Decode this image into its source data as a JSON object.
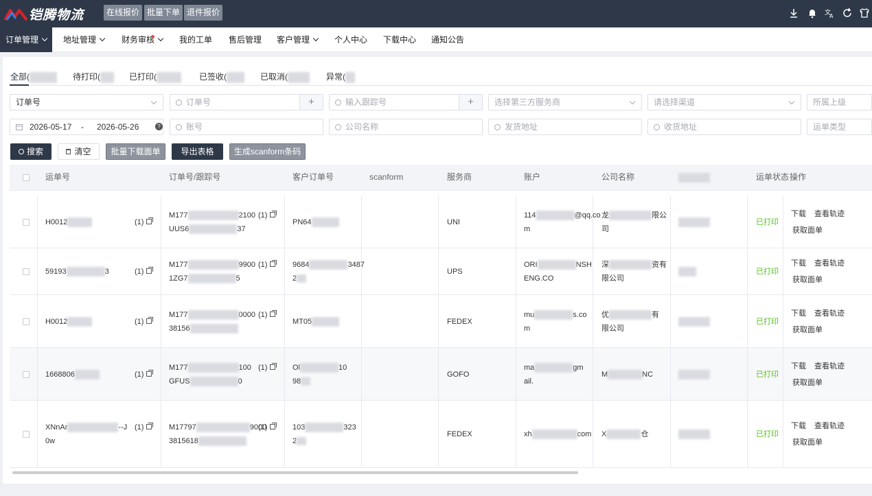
{
  "brand": {
    "name": "铠腾物流"
  },
  "top_buttons": [
    "在线报价",
    "批量下单",
    "退件报价"
  ],
  "nav": [
    {
      "label": "订单管理",
      "dropdown": true
    },
    {
      "label": "地址管理",
      "dropdown": true
    },
    {
      "label": "财务审核",
      "dropdown": true
    },
    {
      "label": "我的工单",
      "dropdown": false
    },
    {
      "label": "售后管理",
      "dropdown": false
    },
    {
      "label": "客户管理",
      "dropdown": true
    },
    {
      "label": "个人中心",
      "dropdown": false
    },
    {
      "label": "下载中心",
      "dropdown": false
    },
    {
      "label": "通知公告",
      "dropdown": false
    }
  ],
  "tabs": [
    "全部(",
    "待打印(",
    "已打印(",
    "已签收(",
    "已取消(",
    "异常("
  ],
  "filters": {
    "order_type": "订单号",
    "order_no": "订单号",
    "tracking": "输入跟踪号",
    "provider": "选择第三方服务商",
    "channel": "请选择渠道",
    "parent": "所属上级",
    "date_from": "2026-05-17",
    "date_sep": "-",
    "date_to": "2026-05-26",
    "account": "账号",
    "company": "公司名称",
    "from_addr": "发货地址",
    "to_addr": "收货地址",
    "waybill_type": "运单类型"
  },
  "actions": [
    "搜索",
    "清空",
    "批量下载面单",
    "导出表格",
    "生成scanform条码"
  ],
  "table": {
    "headers": [
      "运单号",
      "订单号/跟踪号",
      "客户订单号",
      "scanform",
      "服务商",
      "账户",
      "公司名称",
      "",
      "运单状态",
      "操作"
    ],
    "ops": [
      "下载",
      "查看轨迹",
      "获取面单"
    ],
    "rows": [
      {
        "waybill": "H0012",
        "count": "(1)",
        "order1": "M177",
        "order1_tail": "2100",
        "track": "UUS6",
        "track_tail": "37",
        "cust1": "PN64",
        "cust2": "",
        "provider": "UNI",
        "acct1": "114",
        "acct1_tail": "@qq.co",
        "acct2": "m",
        "co1": "龙",
        "co1_tail": "限公",
        "co2": "司",
        "status": "已打印"
      },
      {
        "waybill": "59193",
        "waybill_tail": "3",
        "count": "(1)",
        "order1": "M177",
        "order1_tail": "9900",
        "track": "1ZG7",
        "track_tail": "5",
        "cust1": "9684",
        "cust1_tail": "3487",
        "cust2": "2",
        "provider": "UPS",
        "acct1": "ORI",
        "acct1_tail": "NSH",
        "acct2": "ENG.CO",
        "co1": "深",
        "co1_tail": "资有",
        "co2": "限公司",
        "status": "已打印"
      },
      {
        "waybill": "H0012",
        "count": "(1)",
        "order1": "M177",
        "order1_tail": "0000",
        "track": "38156",
        "track_tail": "",
        "cust1": "MT05",
        "cust2": "",
        "provider": "FEDEX",
        "acct1": "mu",
        "acct1_tail": "s.co",
        "acct2": "m",
        "co1": "优",
        "co1_tail": "有",
        "co2": "限公司",
        "status": "已打印"
      },
      {
        "waybill": "1668806",
        "count": "(1)",
        "order1": "M177",
        "order1_tail": "100",
        "track": "GFUS",
        "track_tail": "0",
        "cust1": "Ol",
        "cust1_tail": "10",
        "cust2": "98",
        "provider": "GOFO",
        "acct1": "ma",
        "acct1_tail": "gm",
        "acct2": "ail.",
        "co1": "M",
        "co1_tail": "NC",
        "co2": "",
        "status": "已打印"
      },
      {
        "waybill": "XNnAr",
        "waybill_tail": "--J",
        "waybill2": "0w",
        "count": "(1)",
        "order1": "M17797",
        "order1_tail": "9000",
        "track": "3815618",
        "track_tail": "",
        "cust1": "103",
        "cust1_tail": "323",
        "cust2": "2",
        "provider": "FEDEX",
        "acct1": "xh",
        "acct1_tail": "com",
        "acct2": "",
        "co1": "X",
        "co1_tail": "仓",
        "co2": "",
        "status": "已打印"
      }
    ]
  }
}
